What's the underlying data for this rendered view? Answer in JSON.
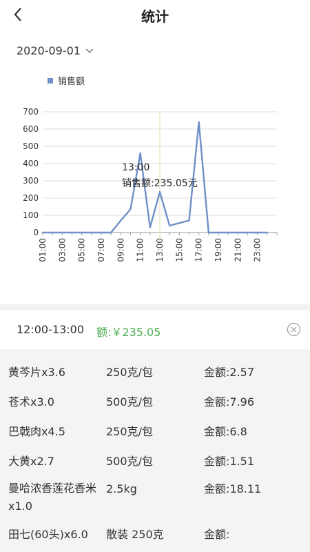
{
  "header": {
    "title": "统计"
  },
  "date_picker": {
    "value": "2020-09-01"
  },
  "chart_data": {
    "type": "line",
    "legend": [
      "销售额"
    ],
    "x": [
      "01:00",
      "02:00",
      "03:00",
      "04:00",
      "05:00",
      "06:00",
      "07:00",
      "08:00",
      "09:00",
      "10:00",
      "11:00",
      "12:00",
      "13:00",
      "14:00",
      "15:00",
      "16:00",
      "17:00",
      "18:00",
      "19:00",
      "20:00",
      "21:00",
      "22:00",
      "23:00",
      "24:00"
    ],
    "x_tick_labels": [
      "01:00",
      "03:00",
      "05:00",
      "07:00",
      "09:00",
      "11:00",
      "13:00",
      "15:00",
      "17:00",
      "19:00",
      "21:00",
      "23:00"
    ],
    "series": [
      {
        "name": "销售额",
        "values": [
          0,
          0,
          0,
          0,
          0,
          0,
          0,
          0,
          70,
          135,
          460,
          30,
          235.05,
          40,
          55,
          70,
          640,
          0,
          0,
          0,
          0,
          0,
          0,
          0
        ]
      }
    ],
    "ylim": [
      0,
      700
    ],
    "y_ticks": [
      0,
      100,
      200,
      300,
      400,
      500,
      600,
      700
    ],
    "grid": true,
    "legend_position": "top-left",
    "tooltip": {
      "time": "13:00",
      "text": "销售额:235.05元"
    },
    "line_color": "#6f8fc8"
  },
  "detail": {
    "range": "12:00-13:00",
    "amount": "额:￥235.05",
    "items": [
      {
        "name": "黄芩片x3.6",
        "spec": "250克/包",
        "amount": "金额:2.57"
      },
      {
        "name": "苍术x3.0",
        "spec": "500克/包",
        "amount": "金额:7.96"
      },
      {
        "name": "巴戟肉x4.5",
        "spec": "250克/包",
        "amount": "金额:6.8"
      },
      {
        "name": "大黄x2.7",
        "spec": "500克/包",
        "amount": "金额:1.51"
      },
      {
        "name": "曼哈浓香莲花香米x1.0",
        "spec": "2.5kg",
        "amount": "金额:18.11"
      },
      {
        "name": "田七(60头)x6.0",
        "spec": "散装 250克",
        "amount": "金额:"
      }
    ]
  }
}
